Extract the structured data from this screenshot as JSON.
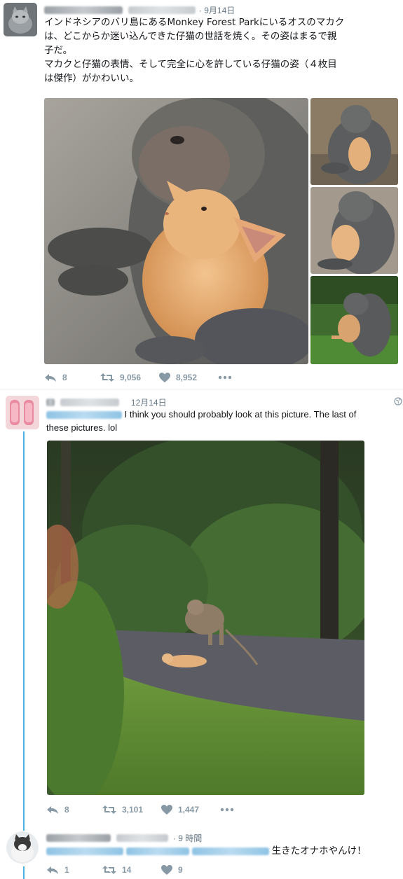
{
  "colors": {
    "accent": "#1da1f2",
    "thread": "#4ab3e2",
    "meta": "#657786",
    "action": "#8899a6"
  },
  "tweet1": {
    "time": "· 9月14日",
    "text_line1": "インドネシアのバリ島にあるMonkey Forest Parkにいるオスのマカク",
    "text_line2": "は、どこからか迷い込んできた仔猫の世話を焼く。その姿はまるで親",
    "text_line3": "子だ。",
    "text_line4": "マカクと仔猫の表情、そして完全に心を許している仔猫の姿（４枚目",
    "text_line5": "は傑作）がかわいい。",
    "reply_count": "8",
    "retweet_count": "9,056",
    "like_count": "8,952"
  },
  "tweet2": {
    "time": "12月14日",
    "text_line1": "I think you should probably look at this picture. The last of",
    "text_line2": "these pictures. lol",
    "reply_count": "8",
    "retweet_count": "3,101",
    "like_count": "1,447"
  },
  "tweet3": {
    "time": "· 9 時間",
    "text": "生きたオナホやんけ！",
    "reply_count": "1",
    "retweet_count": "14",
    "like_count": "9"
  }
}
